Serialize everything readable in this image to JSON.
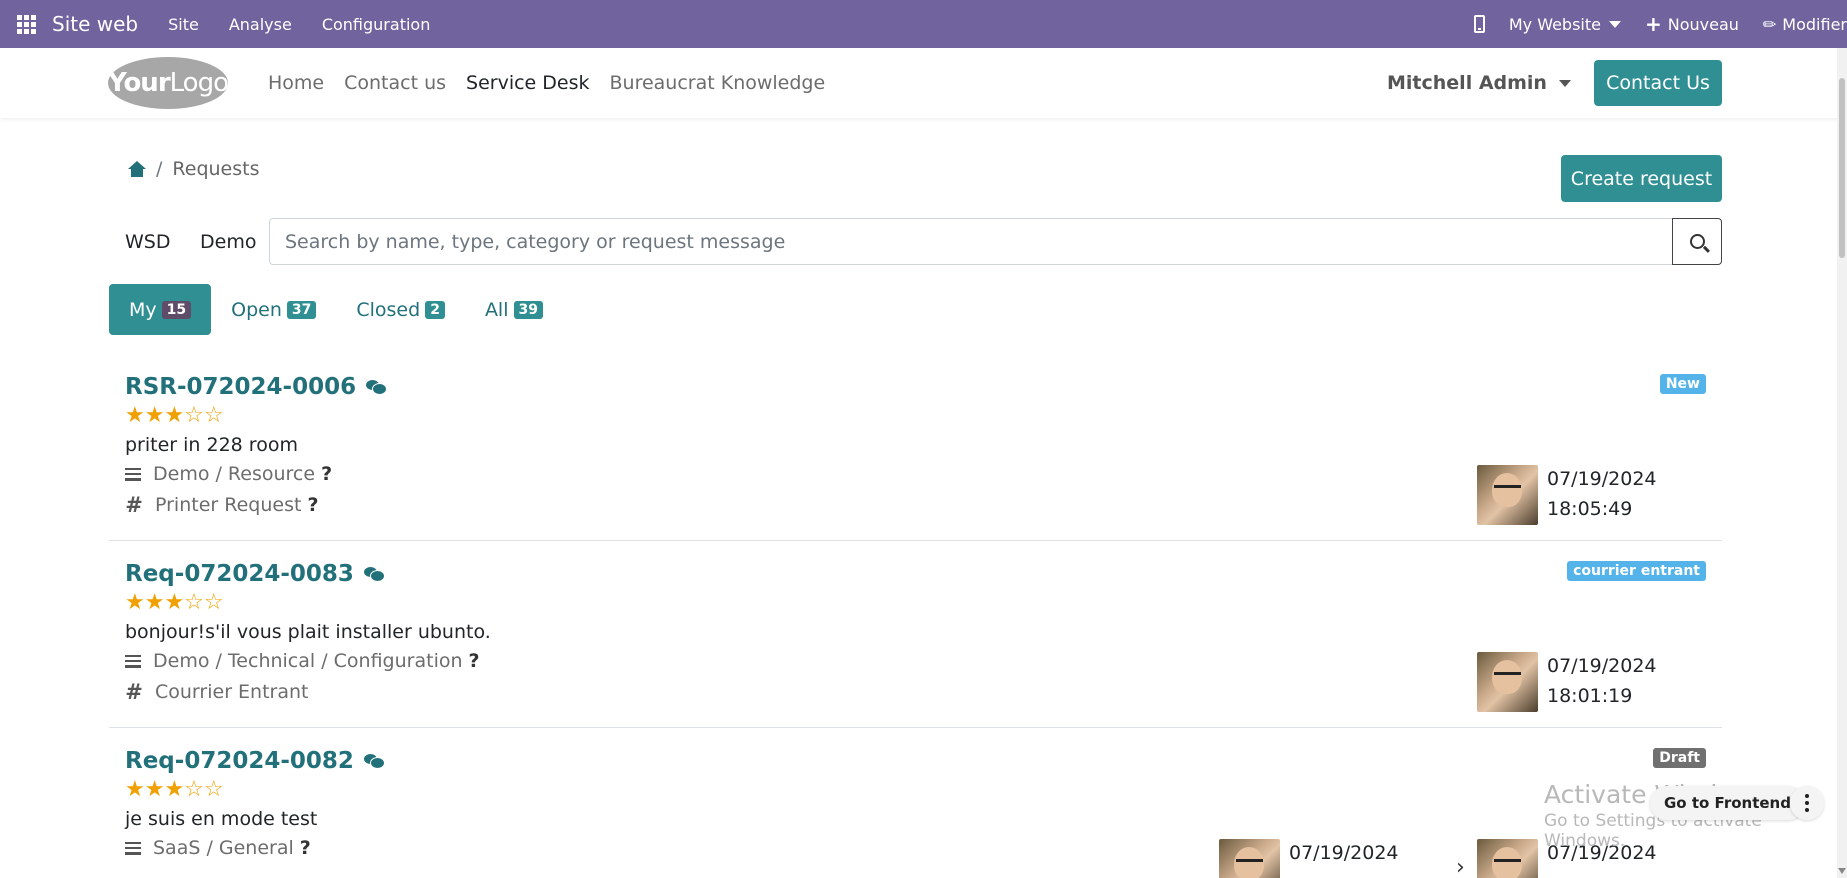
{
  "adminbar": {
    "brand": "Site web",
    "menus": [
      "Site",
      "Analyse",
      "Configuration"
    ],
    "website": "My Website",
    "new": "Nouveau",
    "edit": "Modifier",
    "bg_color": "#71639e"
  },
  "header": {
    "logo_part1": "Your",
    "logo_part2": "Logo",
    "nav": [
      "Home",
      "Contact us",
      "Service Desk",
      "Bureaucrat Knowledge"
    ],
    "active_nav": "Service Desk",
    "user": "Mitchell Admin",
    "contact_button": "Contact Us"
  },
  "breadcrumb": {
    "separator": "/",
    "current": "Requests"
  },
  "create_button": "Create request",
  "filters": [
    "WSD",
    "Demo"
  ],
  "search": {
    "placeholder": "Search by name, type, category or request message"
  },
  "tabs": [
    {
      "label": "My",
      "count": "15"
    },
    {
      "label": "Open",
      "count": "37"
    },
    {
      "label": "Closed",
      "count": "2"
    },
    {
      "label": "All",
      "count": "39"
    }
  ],
  "accent_color": "#2f8f93",
  "requests": [
    {
      "ref": "RSR-072024-0006",
      "rating": 3,
      "stars": "★★★☆☆",
      "message": "priter in 228 room",
      "category": "Demo / Resource",
      "type": "Printer Request",
      "status": "New",
      "status_color": "#54b3e8",
      "date": "07/19/2024",
      "time": "18:05:49"
    },
    {
      "ref": "Req-072024-0083",
      "rating": 3,
      "stars": "★★★☆☆",
      "message": "bonjour!s'il vous plait installer ubunto.",
      "category": "Demo / Technical / Configuration",
      "type": "Courrier Entrant",
      "status": "courrier entrant",
      "status_color": "#54b3e8",
      "date": "07/19/2024",
      "time": "18:01:19"
    },
    {
      "ref": "Req-072024-0082",
      "rating": 3,
      "stars": "★★★☆☆",
      "message": "je suis en mode test",
      "category": "SaaS / General",
      "status": "Draft",
      "status_color": "#707070",
      "date": "07/19/2024",
      "date2": "07/19/2024"
    }
  ],
  "overlay": {
    "watermark_line1": "Activate Windows",
    "watermark_line2": "Go to Settings to activate Windows.",
    "go_frontend": "Go to Frontend"
  }
}
